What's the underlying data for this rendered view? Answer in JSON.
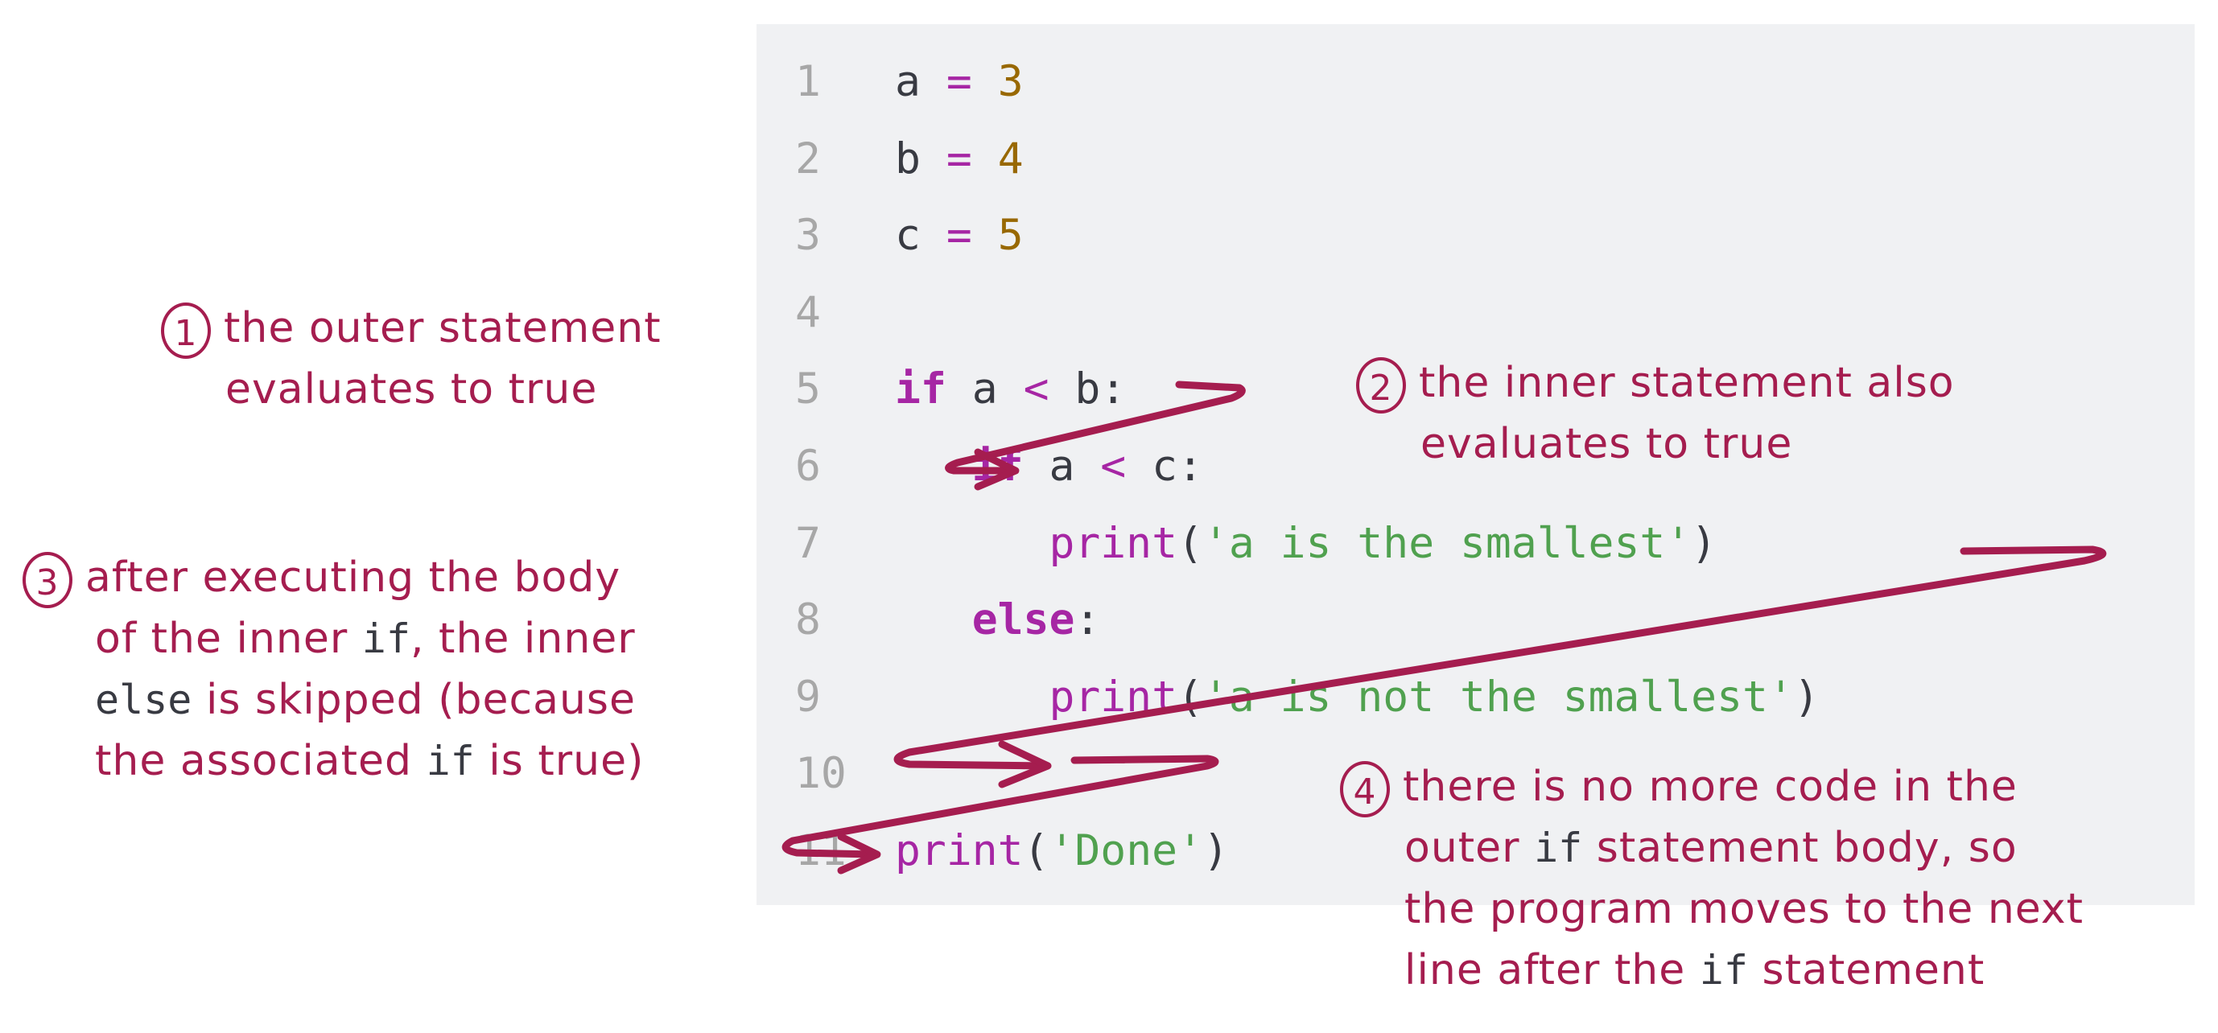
{
  "code": {
    "lines": [
      {
        "n": "1",
        "tokens": [
          {
            "t": "a",
            "c": "var"
          },
          {
            "t": " "
          },
          {
            "t": "=",
            "c": "op"
          },
          {
            "t": " "
          },
          {
            "t": "3",
            "c": "num"
          }
        ]
      },
      {
        "n": "2",
        "tokens": [
          {
            "t": "b",
            "c": "var"
          },
          {
            "t": " "
          },
          {
            "t": "=",
            "c": "op"
          },
          {
            "t": " "
          },
          {
            "t": "4",
            "c": "num"
          }
        ]
      },
      {
        "n": "3",
        "tokens": [
          {
            "t": "c",
            "c": "var"
          },
          {
            "t": " "
          },
          {
            "t": "=",
            "c": "op"
          },
          {
            "t": " "
          },
          {
            "t": "5",
            "c": "num"
          }
        ]
      },
      {
        "n": "4",
        "tokens": []
      },
      {
        "n": "5",
        "tokens": [
          {
            "t": "if",
            "c": "kw"
          },
          {
            "t": " a "
          },
          {
            "t": "<",
            "c": "op"
          },
          {
            "t": " b:"
          }
        ]
      },
      {
        "n": "6",
        "tokens": [
          {
            "t": "   "
          },
          {
            "t": "if",
            "c": "kw"
          },
          {
            "t": " a "
          },
          {
            "t": "<",
            "c": "op"
          },
          {
            "t": " c:"
          }
        ]
      },
      {
        "n": "7",
        "tokens": [
          {
            "t": "      "
          },
          {
            "t": "print",
            "c": "fn"
          },
          {
            "t": "(",
            "c": "pun"
          },
          {
            "t": "'a is the smallest'",
            "c": "str"
          },
          {
            "t": ")",
            "c": "pun"
          }
        ]
      },
      {
        "n": "8",
        "tokens": [
          {
            "t": "   "
          },
          {
            "t": "else",
            "c": "kw"
          },
          {
            "t": ":",
            "c": "pun"
          }
        ]
      },
      {
        "n": "9",
        "tokens": [
          {
            "t": "      "
          },
          {
            "t": "print",
            "c": "fn"
          },
          {
            "t": "(",
            "c": "pun"
          },
          {
            "t": "'a is not the smallest'",
            "c": "str"
          },
          {
            "t": ")",
            "c": "pun"
          }
        ]
      },
      {
        "n": "10",
        "tokens": []
      },
      {
        "n": "11",
        "tokens": [
          {
            "t": "print",
            "c": "fn"
          },
          {
            "t": "(",
            "c": "pun"
          },
          {
            "t": "'Done'",
            "c": "str"
          },
          {
            "t": ")",
            "c": "pun"
          }
        ]
      }
    ]
  },
  "annotations": [
    {
      "badge": "1",
      "lines": [
        [
          {
            "t": "the outer statement"
          }
        ],
        [
          {
            "t": "evaluates to true"
          }
        ]
      ]
    },
    {
      "badge": "2",
      "lines": [
        [
          {
            "t": "the inner statement also"
          }
        ],
        [
          {
            "t": "evaluates to true"
          }
        ]
      ]
    },
    {
      "badge": "3",
      "lines": [
        [
          {
            "t": "after executing the body"
          }
        ],
        [
          {
            "t": "of the inner "
          },
          {
            "t": "if",
            "mono": true
          },
          {
            "t": ", the inner"
          }
        ],
        [
          {
            "t": "else",
            "mono": true
          },
          {
            "t": " is skipped (because"
          }
        ],
        [
          {
            "t": "the associated "
          },
          {
            "t": "if",
            "mono": true
          },
          {
            "t": " is true)"
          }
        ]
      ]
    },
    {
      "badge": "4",
      "lines": [
        [
          {
            "t": "there is no more code in the"
          }
        ],
        [
          {
            "t": "outer "
          },
          {
            "t": "if",
            "mono": true
          },
          {
            "t": " statement body, so"
          }
        ],
        [
          {
            "t": "the program moves to the next"
          }
        ],
        [
          {
            "t": "line after the "
          },
          {
            "t": "if",
            "mono": true
          },
          {
            "t": " statement"
          }
        ]
      ]
    }
  ],
  "colors": {
    "annotation": "#a51d4f",
    "keyword": "#a626a4",
    "number": "#986801",
    "string": "#50a14f",
    "line_number": "#a7a7a7",
    "panel_bg": "#f0f1f3"
  }
}
